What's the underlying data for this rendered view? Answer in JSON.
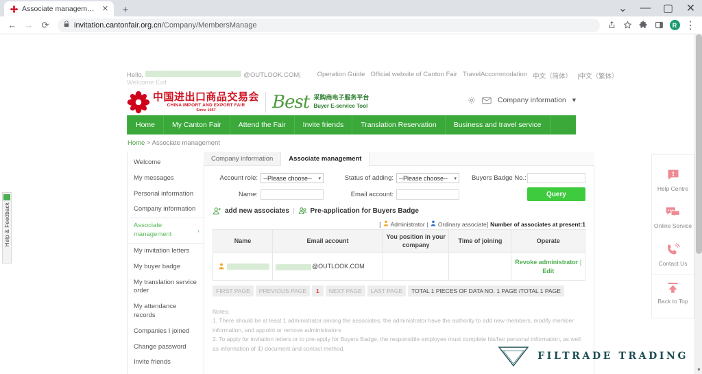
{
  "browser": {
    "tab": {
      "title": "Associate management",
      "favicon_icon": "canton-fair-flower-icon",
      "close_icon": "✕"
    },
    "newtab_icon": "+",
    "window_controls": [
      {
        "name": "minimize-to-tray-button",
        "glyph": "⌄"
      },
      {
        "name": "minimize-button",
        "glyph": "—"
      },
      {
        "name": "maximize-button",
        "glyph": "▢"
      },
      {
        "name": "close-window-button",
        "glyph": "✕"
      }
    ],
    "back_icon": "←",
    "forward_icon": "→",
    "reload_icon": "⟳",
    "lock_icon": "padlock-icon",
    "url_host": "invitation.cantonfair.org.cn",
    "url_path": "/Company/MembersManage",
    "toolbar_icons": [
      {
        "name": "share-icon",
        "glyph": "⤴"
      },
      {
        "name": "bookmark-star-icon",
        "glyph": "☆"
      },
      {
        "name": "extensions-puzzle-icon",
        "glyph": "🧩"
      },
      {
        "name": "side-panel-icon",
        "glyph": "▣"
      }
    ],
    "avatar_letter": "R",
    "menu_icon": "⋮"
  },
  "feedback": {
    "label": "Help & Feedback"
  },
  "header": {
    "hello_prefix": "Hello,",
    "email_suffix": "@OUTLOOK.COM|",
    "welcome_exit": "Welcome Exit",
    "links": [
      "Operation Guide",
      "Official website of Canton Fair",
      "TravelAccommodation",
      "中文（简体）",
      "|中文（繁体）"
    ],
    "logo": {
      "cn_name": "中国进出口商品交易会",
      "en_name": "CHINA IMPORT AND EXPORT FAIR",
      "since": "Since 1957",
      "best_word": "Best",
      "best_cn": "采购商电子服务平台",
      "best_en": "Buyer E-service Tool"
    },
    "gear_icon": "gear-icon",
    "mail_icon": "envelope-icon",
    "account_menu": "Company information",
    "account_caret": "▾"
  },
  "mainnav": [
    "Home",
    "My Canton Fair",
    "Attend the Fair",
    "Invite friends",
    "Translation Reservation",
    "Business and travel service"
  ],
  "breadcrumb": {
    "home": "Home",
    "sep": ">",
    "current": "Associate management"
  },
  "sidebar": {
    "items": [
      {
        "label": "Welcome",
        "active": false
      },
      {
        "label": "My messages",
        "active": false
      },
      {
        "label": "Personal information",
        "active": false
      },
      {
        "label": "Company information",
        "active": false
      },
      {
        "label": "Associate management",
        "active": true
      },
      {
        "label": "My invitation letters",
        "active": false
      },
      {
        "label": "My buyer badge",
        "active": false
      },
      {
        "label": "My translation service order",
        "active": false
      },
      {
        "label": "My attendance records",
        "active": false
      },
      {
        "label": "Companies I joined",
        "active": false
      },
      {
        "label": "Change password",
        "active": false
      },
      {
        "label": "Invite friends",
        "active": false
      }
    ],
    "chevron": "›"
  },
  "panel": {
    "tabs": [
      {
        "label": "Company information",
        "active": false
      },
      {
        "label": "Associate management",
        "active": true
      }
    ],
    "form": {
      "account_role_label": "Account role:",
      "account_role_value": "--Please choose--",
      "status_label": "Status of adding:",
      "status_value": "--Please choose--",
      "badge_label": "Buyers Badge No.:",
      "badge_value": "",
      "name_label": "Name:",
      "name_value": "",
      "email_label": "Email account:",
      "email_value": "",
      "query_button": "Query",
      "caret": "▾"
    },
    "actions": {
      "add_new": "add new associates",
      "separator": "|",
      "pre_application": "Pre-application for Buyers Badge"
    },
    "legend": {
      "open_bracket": "[",
      "admin_label": "Administrator",
      "pipe": "|",
      "ordinary_label": "Ordinary associate]",
      "count_text": "Number of associates at present:1"
    },
    "table": {
      "columns": [
        "Name",
        "Email account",
        "You position in your company",
        "Time of joining",
        "Operate"
      ],
      "rows": [
        {
          "name": "",
          "email_suffix": "@OUTLOOK.COM",
          "position": "",
          "time_of_joining": "",
          "operate_primary": "Revoke administrator",
          "operate_sep": "|",
          "operate_secondary": "Edit"
        }
      ]
    },
    "pager": {
      "first": "FIRST PAGE",
      "previous": "PREVIOUS PAGE",
      "current": "1",
      "next": "NEXT PAGE",
      "last": "LAST PAGE",
      "info": "TOTAL 1 PIECES OF DATA NO. 1 PAGE /TOTAL 1 PAGE"
    },
    "notes": {
      "title": "Notes:",
      "line1": "1. There should be at least 1 administrator among the associates; the administrator have the authority to add new members, modify member information, and appoint or remove administrators",
      "line2": "2. To apply for invitation letters or to pre-apply for Buyers Badge, the responsible employee must complete his/her personal information, as well as information of ID document and contact method."
    }
  },
  "floatbar": [
    {
      "label": "Help Centre",
      "icon": "help-exclamation-bubble-icon"
    },
    {
      "label": "Online Service",
      "icon": "chat-bubbles-icon"
    },
    {
      "label": "Contact Us",
      "icon": "phone-ringing-icon"
    },
    {
      "label": "Back to Top",
      "icon": "arrow-up-icon"
    }
  ],
  "footer_brand": {
    "text": "FILTRADE TRADING",
    "mark": "triangle-logo-icon"
  },
  "colors": {
    "nav_green": "#3aa93a",
    "accent_green": "#4caf50",
    "query_green": "#3ecb3e",
    "brand_red": "#cf1322",
    "float_pink": "#ef8a93",
    "page_current_red": "#e03b3b"
  }
}
